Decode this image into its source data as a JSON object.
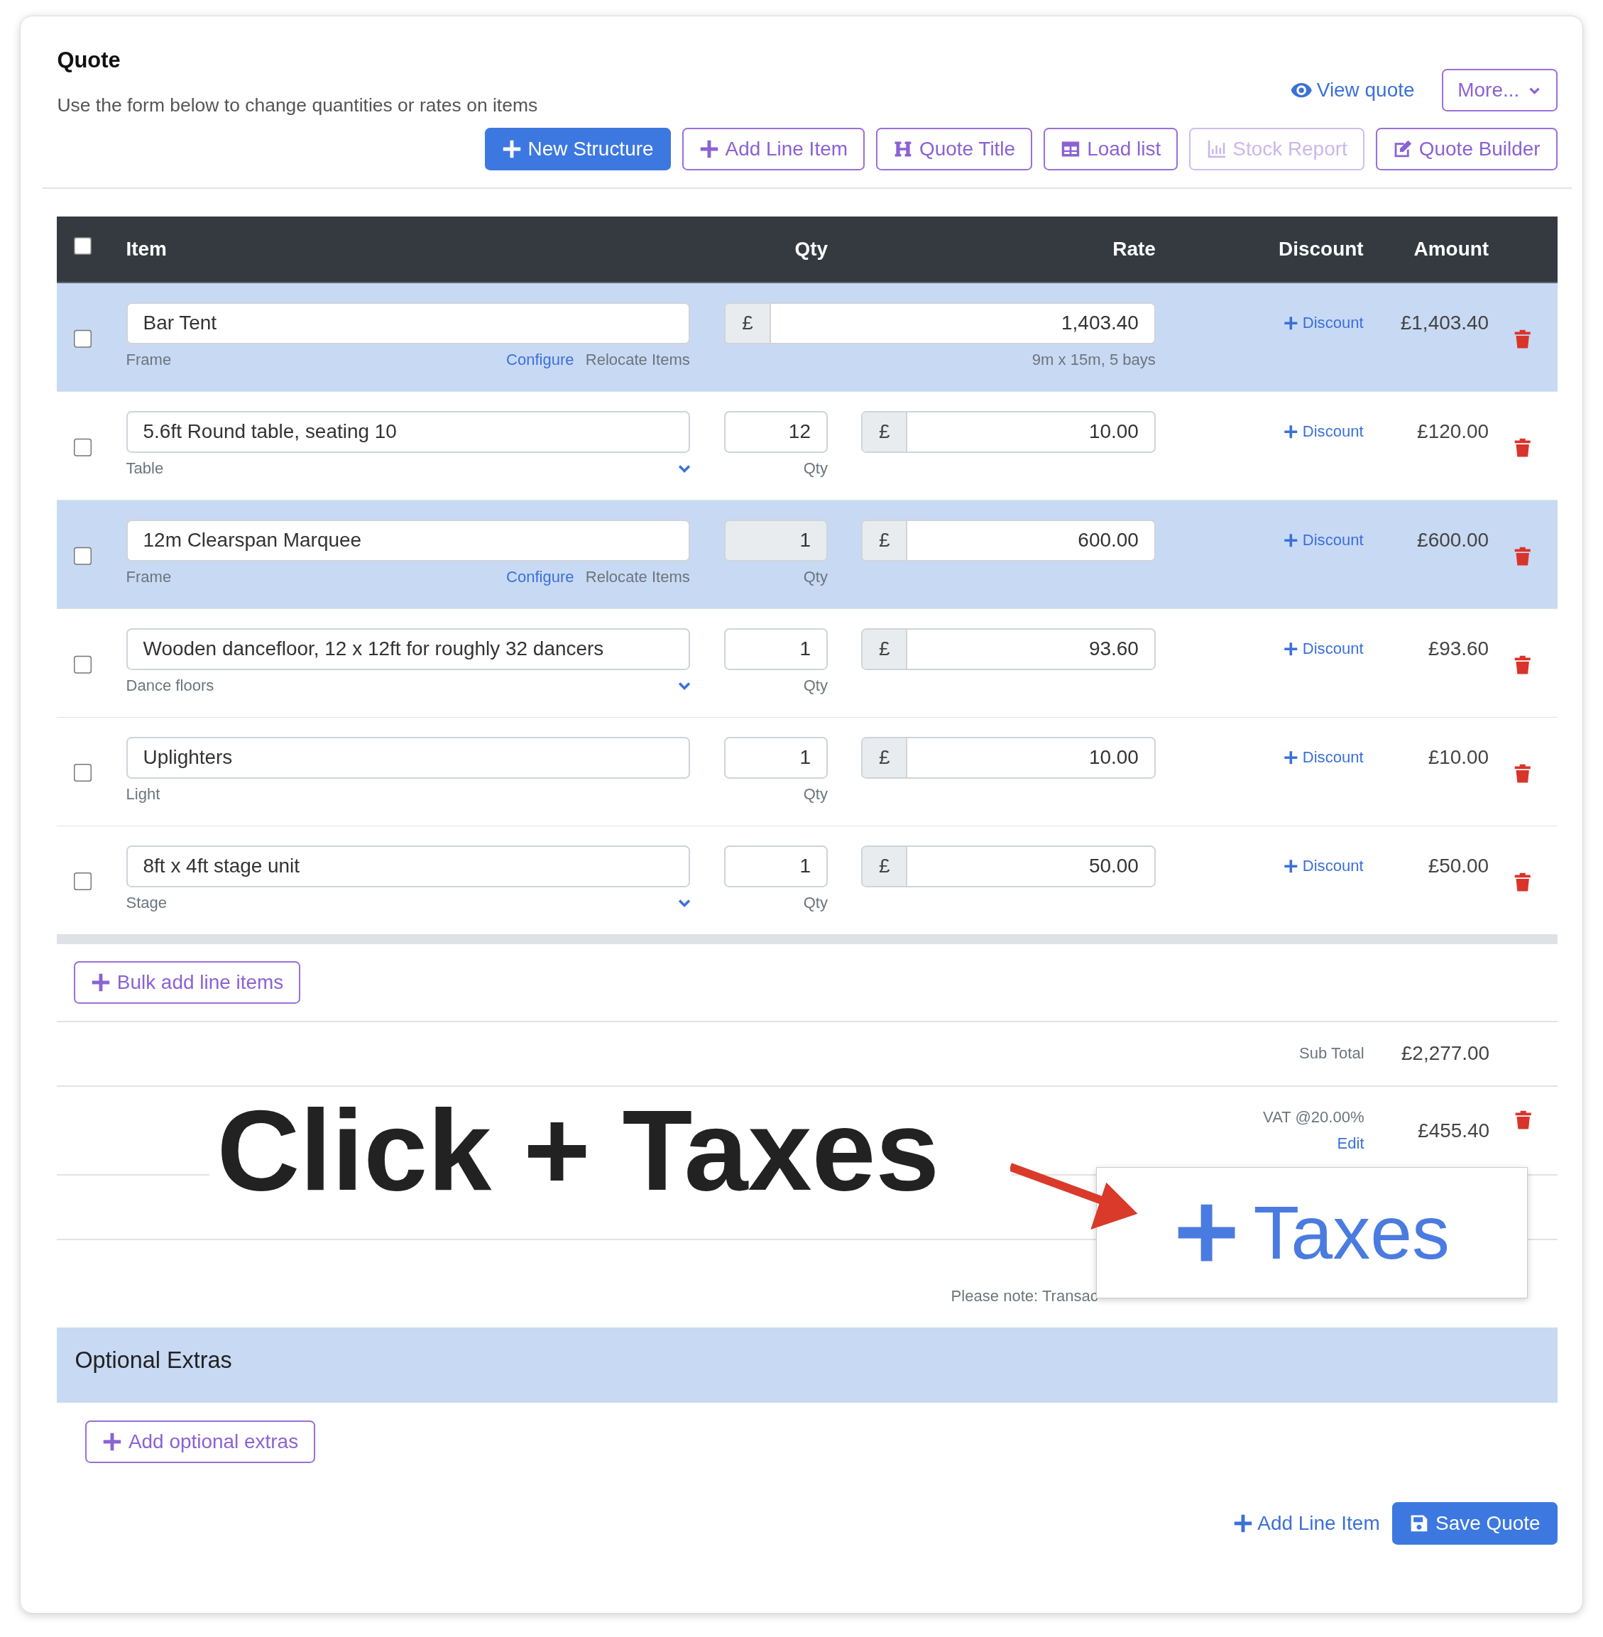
{
  "header": {
    "title": "Quote",
    "subtitle": "Use the form below to change quantities or rates on items",
    "view_link": "View quote",
    "more_button": "More..."
  },
  "toolbar": [
    {
      "label": "New Structure",
      "kind": "primary",
      "disabled": false
    },
    {
      "label": "Add Line Item",
      "kind": "outline",
      "disabled": false
    },
    {
      "label": "Quote Title",
      "kind": "outline",
      "disabled": false
    },
    {
      "label": "Load list",
      "kind": "outline",
      "disabled": false
    },
    {
      "label": "Stock Report",
      "kind": "outline",
      "disabled": true
    },
    {
      "label": "Quote Builder",
      "kind": "outline",
      "disabled": false
    }
  ],
  "table": {
    "columns": [
      "Item",
      "Qty",
      "Rate",
      "Discount",
      "Amount"
    ],
    "select_all_checked": false,
    "rows": [
      {
        "kind": "structure",
        "checked": false,
        "name": "Bar Tent",
        "category": "Frame",
        "configure_link": "Configure",
        "relocate_link": "Relocate Items",
        "currency": "£",
        "rate": "1,403.40",
        "rate_note": "9m x 15m, 5 bays",
        "discount_link": "Discount",
        "amount": "£1,403.40"
      },
      {
        "kind": "item",
        "checked": false,
        "name": "5.6ft Round table, seating 10",
        "category": "Table",
        "dropdown": true,
        "qty": "12",
        "qty_label": "Qty",
        "qty_disabled": false,
        "currency": "£",
        "rate": "10.00",
        "discount_link": "Discount",
        "amount": "£120.00"
      },
      {
        "kind": "structure",
        "checked": false,
        "name": "12m Clearspan Marquee",
        "category": "Frame",
        "configure_link": "Configure",
        "relocate_link": "Relocate Items",
        "qty": "1",
        "qty_label": "Qty",
        "qty_disabled": true,
        "currency": "£",
        "rate": "600.00",
        "discount_link": "Discount",
        "amount": "£600.00"
      },
      {
        "kind": "item",
        "checked": false,
        "name": "Wooden dancefloor, 12 x 12ft for roughly 32 dancers",
        "category": "Dance floors",
        "dropdown": true,
        "qty": "1",
        "qty_label": "Qty",
        "qty_disabled": false,
        "currency": "£",
        "rate": "93.60",
        "discount_link": "Discount",
        "amount": "£93.60"
      },
      {
        "kind": "item",
        "checked": false,
        "name": "Uplighters",
        "category": "Light",
        "dropdown": false,
        "qty": "1",
        "qty_label": "Qty",
        "qty_disabled": false,
        "currency": "£",
        "rate": "10.00",
        "discount_link": "Discount",
        "amount": "£10.00"
      },
      {
        "kind": "item",
        "checked": false,
        "name": "8ft x 4ft stage unit",
        "category": "Stage",
        "dropdown": true,
        "qty": "1",
        "qty_label": "Qty",
        "qty_disabled": false,
        "currency": "£",
        "rate": "50.00",
        "discount_link": "Discount",
        "amount": "£50.00"
      }
    ]
  },
  "bulk_add_button": "Bulk add line items",
  "totals": [
    {
      "label": "Sub Total",
      "amount": "£2,277.00",
      "deletable": false
    },
    {
      "label": "VAT @20.00%",
      "amount": "£455.40",
      "edit_link": "Edit",
      "deletable": true
    }
  ],
  "note": "Please note: Transac",
  "optional_extras": {
    "title": "Optional Extras",
    "add_button": "Add optional extras"
  },
  "footer": {
    "add_link": "Add Line Item",
    "save_button": "Save Quote"
  },
  "annotation": {
    "caption": "Click + Taxes",
    "callout": "Taxes"
  }
}
